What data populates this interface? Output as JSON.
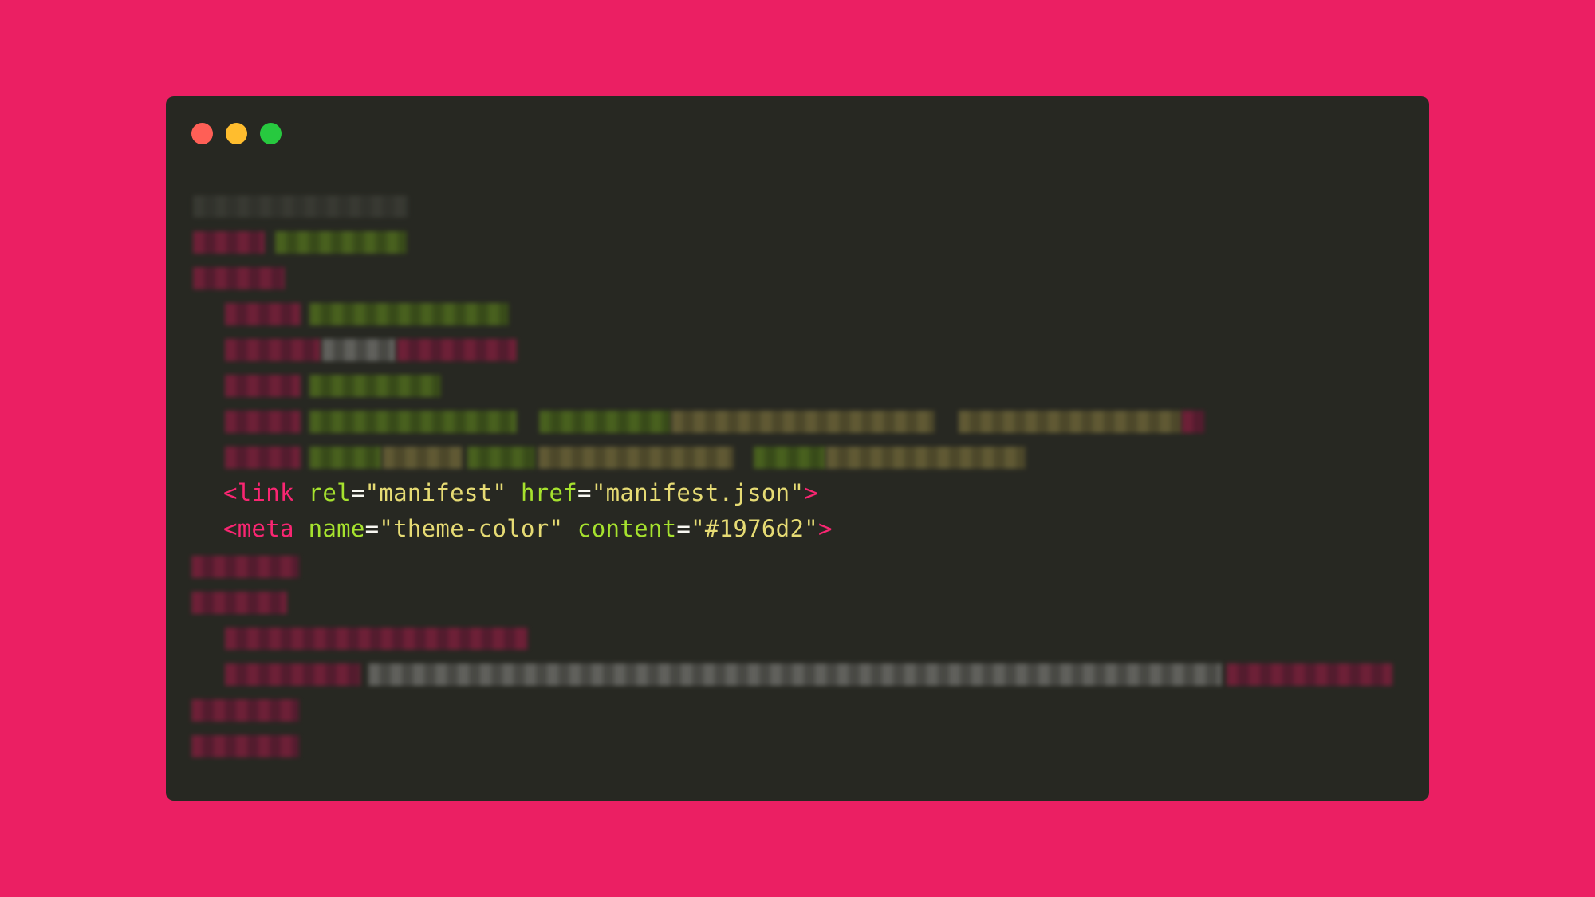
{
  "window": {
    "controls": [
      "close",
      "minimize",
      "maximize"
    ],
    "colors": {
      "background": "#eb1f63",
      "editor": "#272822",
      "close": "#ff5f56",
      "minimize": "#ffbd2e",
      "maximize": "#27c93f"
    }
  },
  "code": {
    "line1": {
      "open": "<link",
      "attr1": "rel",
      "val1": "\"manifest\"",
      "attr2": "href",
      "val2": "\"manifest.json\"",
      "close": ">"
    },
    "line2": {
      "open": "<meta",
      "attr1": "name",
      "val1": "\"theme-color\"",
      "attr2": "content",
      "val2": "\"#1976d2\"",
      "close": ">"
    },
    "equals": "="
  }
}
